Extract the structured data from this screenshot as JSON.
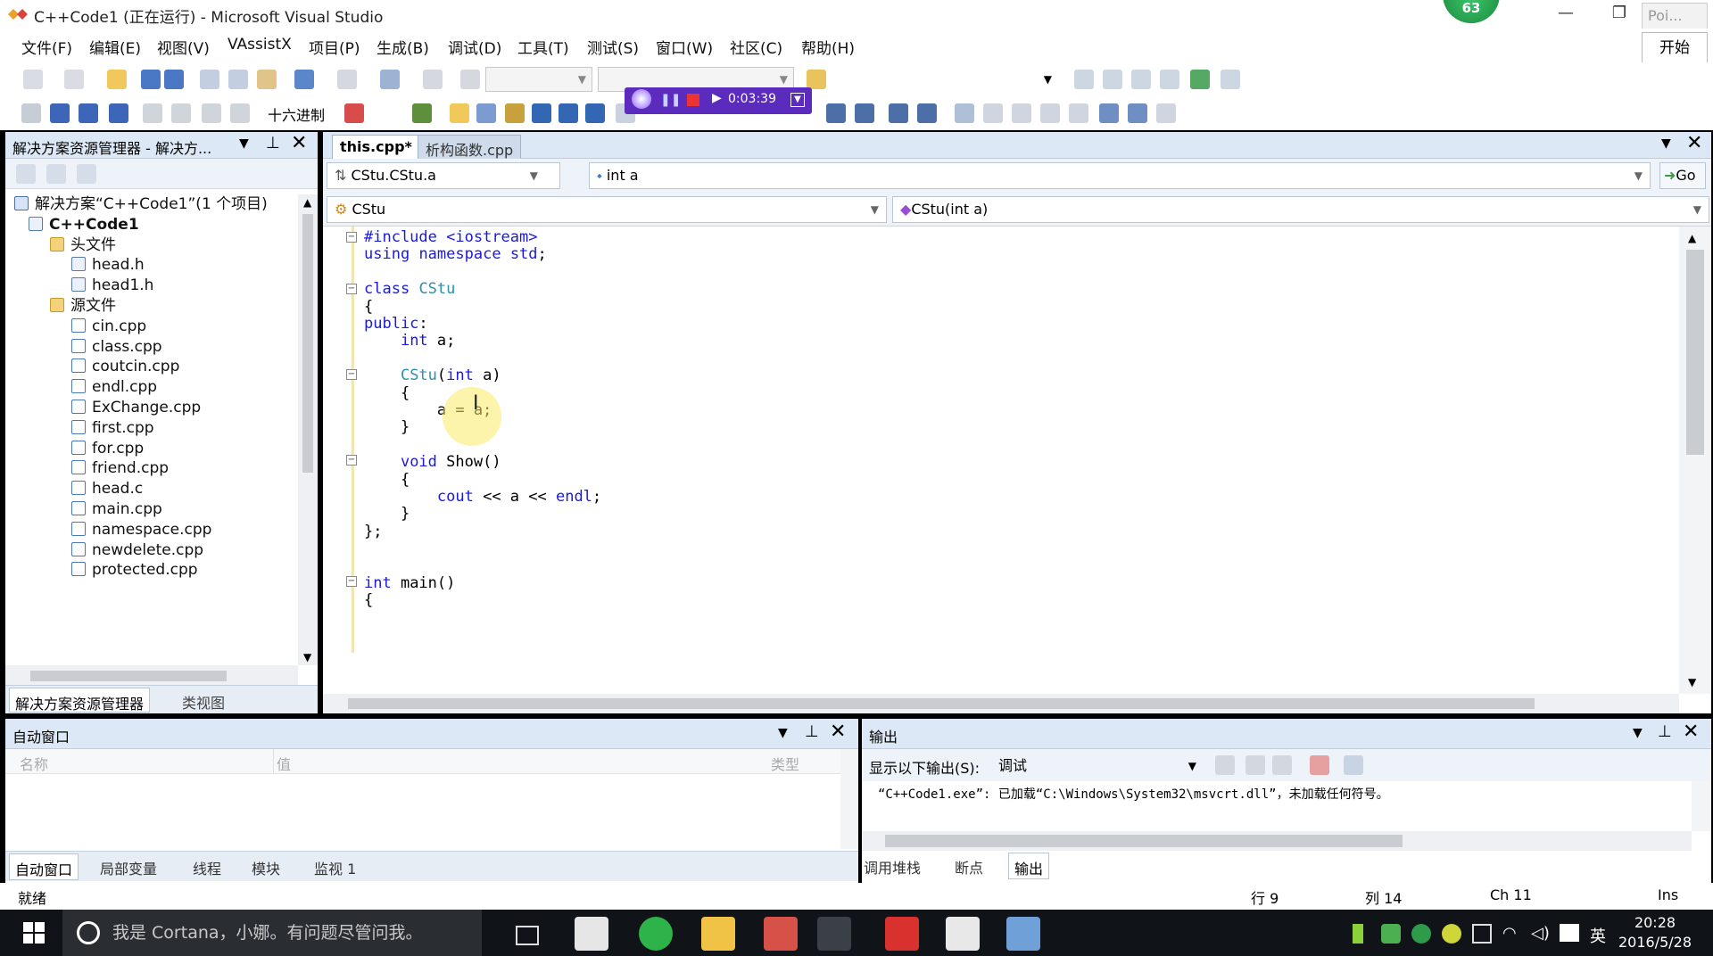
{
  "window": {
    "title": "C++Code1 (正在运行) - Microsoft Visual Studio",
    "badge": "63",
    "poi_label": "Poi...",
    "start_label": "开始",
    "min": "—",
    "restore": "❐",
    "close": "✕"
  },
  "menu": [
    "文件(F)",
    "编辑(E)",
    "视图(V)",
    "VAssistX",
    "项目(P)",
    "生成(B)",
    "调试(D)",
    "工具(T)",
    "测试(S)",
    "窗口(W)",
    "社区(C)",
    "帮助(H)"
  ],
  "toolbar": {
    "hex_label": "十六进制",
    "recording_time": "0:03:39"
  },
  "solution_explorer": {
    "title": "解决方案资源管理器 - 解决方...",
    "tree": [
      {
        "label": "解决方案“C++Code1”(1 个项目)",
        "type": "solution",
        "level": 0
      },
      {
        "label": "C++Code1",
        "type": "project",
        "level": 1,
        "bold": true
      },
      {
        "label": "头文件",
        "type": "folder",
        "level": 2
      },
      {
        "label": "head.h",
        "type": "header",
        "level": 3
      },
      {
        "label": "head1.h",
        "type": "header",
        "level": 3
      },
      {
        "label": "源文件",
        "type": "folder",
        "level": 2
      },
      {
        "label": "cin.cpp",
        "type": "cpp",
        "level": 3
      },
      {
        "label": "class.cpp",
        "type": "cpp",
        "level": 3
      },
      {
        "label": "coutcin.cpp",
        "type": "cpp",
        "level": 3
      },
      {
        "label": "endl.cpp",
        "type": "cpp",
        "level": 3
      },
      {
        "label": "ExChange.cpp",
        "type": "cpp",
        "level": 3
      },
      {
        "label": "first.cpp",
        "type": "cpp",
        "level": 3
      },
      {
        "label": "for.cpp",
        "type": "cpp",
        "level": 3
      },
      {
        "label": "friend.cpp",
        "type": "cpp",
        "level": 3
      },
      {
        "label": "head.c",
        "type": "cpp",
        "level": 3
      },
      {
        "label": "main.cpp",
        "type": "cpp",
        "level": 3
      },
      {
        "label": "namespace.cpp",
        "type": "cpp",
        "level": 3
      },
      {
        "label": "newdelete.cpp",
        "type": "cpp",
        "level": 3
      },
      {
        "label": "protected.cpp",
        "type": "cpp",
        "level": 3
      }
    ],
    "tabs": [
      "解决方案资源管理器",
      "类视图"
    ]
  },
  "editor": {
    "tabs": [
      "this.cpp*",
      "析构函数.cpp"
    ],
    "nav_scope": "CStu.CStu.a",
    "nav_member": "int a",
    "go_label": "Go",
    "class_combo": "CStu",
    "method_combo": "CStu(int a)",
    "code": [
      "#include <iostream>",
      "using namespace std;",
      "",
      "class CStu",
      "{",
      "public:",
      "    int a;",
      "",
      "    CStu(int a)",
      "    {",
      "        a = a;",
      "    }",
      "",
      "    void Show()",
      "    {",
      "        cout << a << endl;",
      "    }",
      "};",
      "",
      "",
      "int main()",
      "{"
    ]
  },
  "auto_window": {
    "title": "自动窗口",
    "col_name": "名称",
    "col_value": "值",
    "col_type": "类型",
    "tabs": [
      "自动窗口",
      "局部变量",
      "线程",
      "模块",
      "监视 1"
    ]
  },
  "output": {
    "title": "输出",
    "show_label": "显示以下输出(S):",
    "source": "调试",
    "text": "“C++Code1.exe”: 已加载“C:\\Windows\\System32\\msvcrt.dll”，未加载任何符号。",
    "tabs": [
      "调用堆栈",
      "断点",
      "输出"
    ]
  },
  "status": {
    "ready": "就绪",
    "line": "行 9",
    "col": "列 14",
    "ch": "Ch 11",
    "ins": "Ins"
  },
  "taskbar": {
    "search": "我是 Cortana，小娜。有问题尽管问我。",
    "time": "20:28",
    "date": "2016/5/28",
    "ime": "英"
  }
}
